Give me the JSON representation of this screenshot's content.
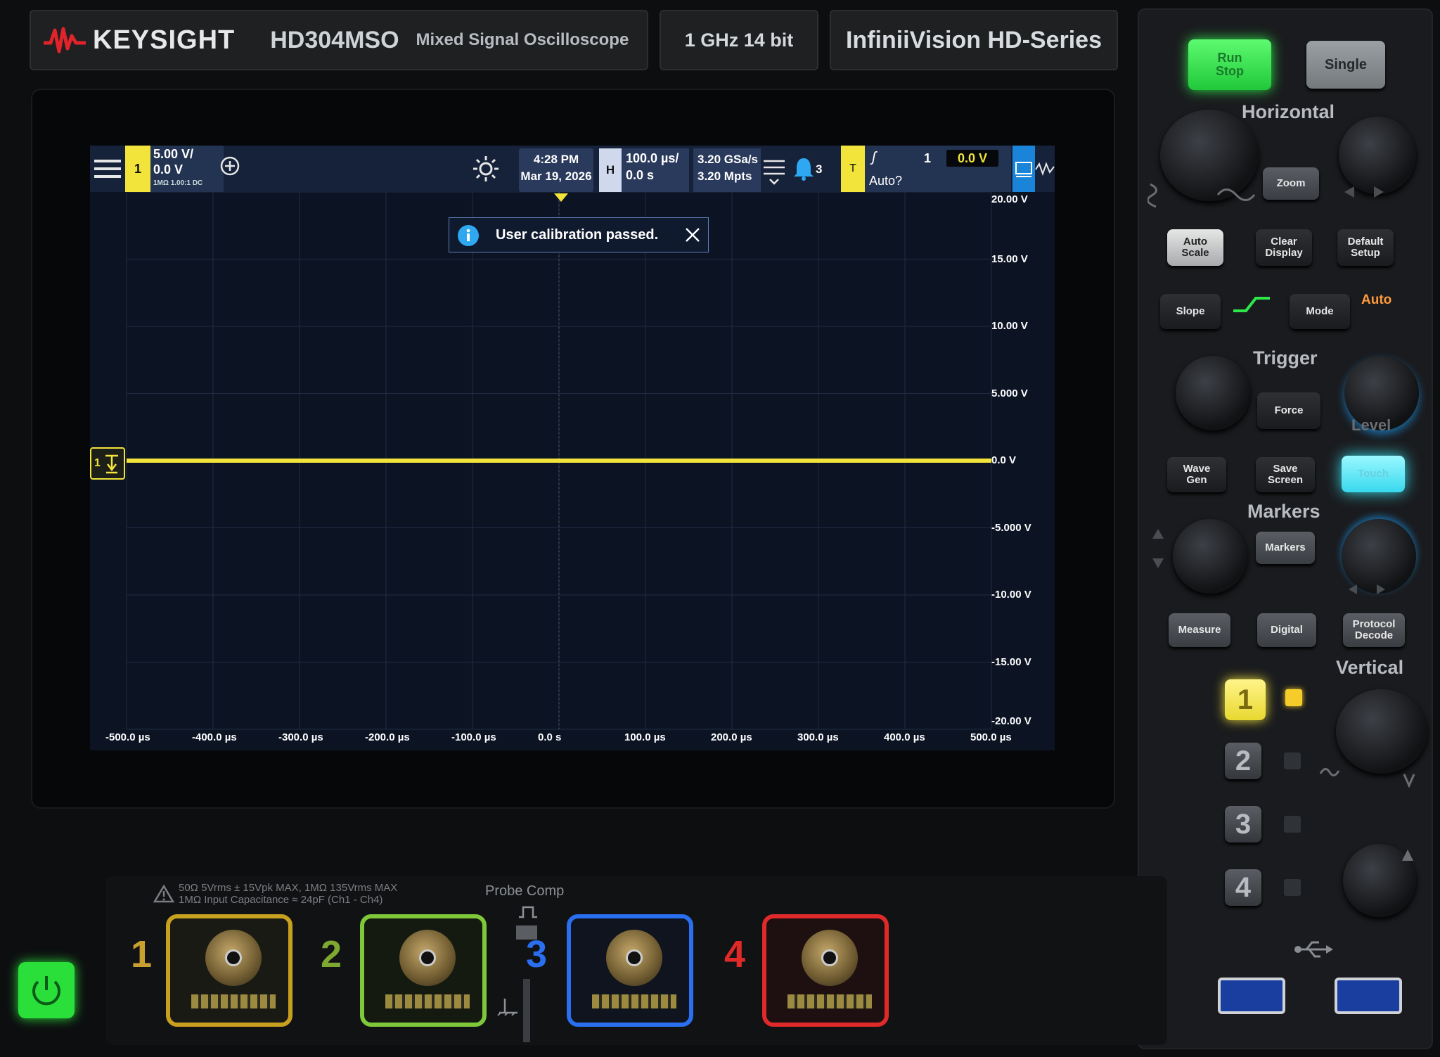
{
  "brand": {
    "name": "KEYSIGHT",
    "model": "HD304MSO",
    "model_desc": "Mixed Signal Oscilloscope",
    "spec": "1 GHz  14 bit",
    "series": "InfiniiVision  HD-Series"
  },
  "status_bar": {
    "channel1": {
      "num": "1",
      "scale": "5.00 V/",
      "offset": "0.0 V",
      "details": "1MΩ  1.00:1  DC"
    },
    "datetime": {
      "time": "4:28 PM",
      "date": "Mar 19, 2026"
    },
    "horizontal": {
      "tab": "H",
      "scale": "100.0 µs/",
      "delay": "0.0 s"
    },
    "sample": {
      "rate": "3.20 GSa/s",
      "memory": "3.20 Mpts"
    },
    "notifications": {
      "count": "3"
    },
    "trigger": {
      "tab": "T",
      "slope_glyph": "ʃ",
      "source": "1",
      "level": "0.0 V",
      "mode": "Auto?"
    }
  },
  "toast": {
    "message": "User calibration passed."
  },
  "ch1_marker": {
    "label": "1"
  },
  "y_axis": [
    "20.00 V",
    "15.00 V",
    "10.00 V",
    "5.000 V",
    "0.0 V",
    "-5.000 V",
    "-10.00 V",
    "-15.00 V",
    "-20.00 V"
  ],
  "x_axis": [
    "-500.0 µs",
    "-400.0 µs",
    "-300.0 µs",
    "-200.0 µs",
    "-100.0 µs",
    "0.0 s",
    "100.0 µs",
    "200.0 µs",
    "300.0 µs",
    "400.0 µs",
    "500.0 µs"
  ],
  "waveform": {
    "level_volts": 0.0,
    "volts_per_div": 5.0,
    "color": "#f2e43a"
  },
  "panel": {
    "run_stop": {
      "line1": "Run",
      "line2": "Stop"
    },
    "single": "Single",
    "horizontal_title": "Horizontal",
    "zoom": "Zoom",
    "auto_scale": {
      "line1": "Auto",
      "line2": "Scale"
    },
    "clear_display": {
      "line1": "Clear",
      "line2": "Display"
    },
    "default_setup": {
      "line1": "Default",
      "line2": "Setup"
    },
    "slope": "Slope",
    "mode": "Mode",
    "auto_indicator": "Auto",
    "trigger_title": "Trigger",
    "force": "Force",
    "level": "Level",
    "wave_gen": {
      "line1": "Wave",
      "line2": "Gen"
    },
    "save_screen": {
      "line1": "Save",
      "line2": "Screen"
    },
    "touch": "Touch",
    "markers_title": "Markers",
    "markers": "Markers",
    "measure": "Measure",
    "digital": "Digital",
    "protocol_decode": {
      "line1": "Protocol",
      "line2": "Decode"
    },
    "vertical_title": "Vertical",
    "channels": [
      "1",
      "2",
      "3",
      "4"
    ]
  },
  "front": {
    "warning_line1": "50Ω 5Vrms ± 15Vpk MAX, 1MΩ 135Vrms MAX",
    "warning_line2": "1MΩ Input Capacitance ≈ 24pF (Ch1 - Ch4)",
    "probe_comp": "Probe Comp",
    "channel_labels": [
      "1",
      "2",
      "3",
      "4"
    ]
  },
  "colors": {
    "ch1": "#f2e43a",
    "ch2": "#7ec83a",
    "ch3": "#2a6ff0",
    "ch4": "#e02a2a",
    "run": "#2ee84a",
    "touch": "#3ae0f0"
  }
}
